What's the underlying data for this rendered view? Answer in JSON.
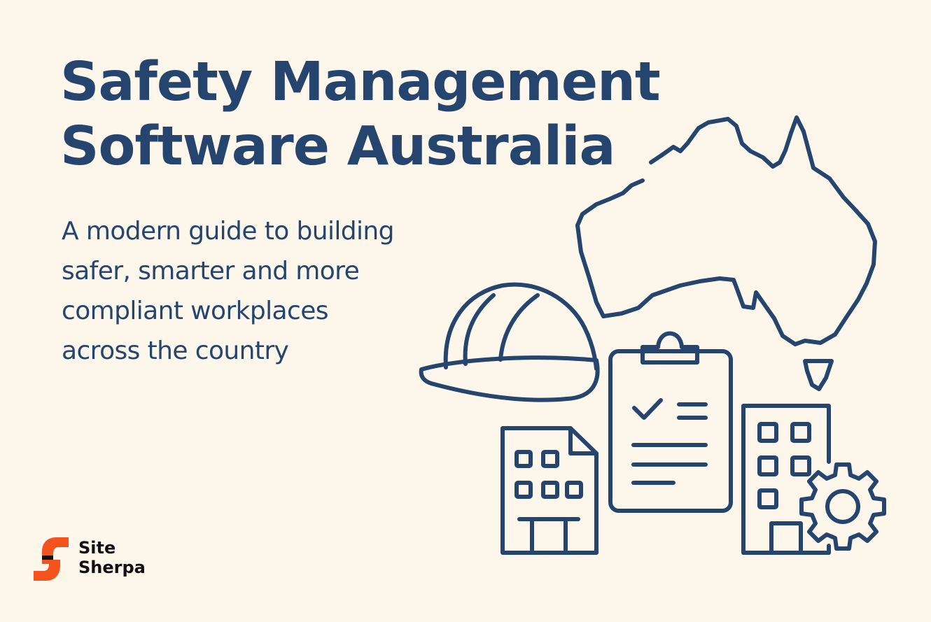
{
  "headline": {
    "line1": "Safety Management",
    "line2": "Software Australia"
  },
  "subheadline": {
    "line1": "A modern guide to building",
    "line2": "safer, smarter and more",
    "line3": "compliant workplaces",
    "line4": "across the country"
  },
  "brand": {
    "line1": "Site",
    "line2": "Sherpa",
    "mark_color": "#f4531e"
  },
  "colors": {
    "background": "#fdf6ea",
    "ink": "#25456f"
  },
  "icons": [
    "australia-map-icon",
    "hard-hat-icon",
    "clipboard-checklist-icon",
    "building-document-icon",
    "building-icon",
    "gear-icon"
  ]
}
